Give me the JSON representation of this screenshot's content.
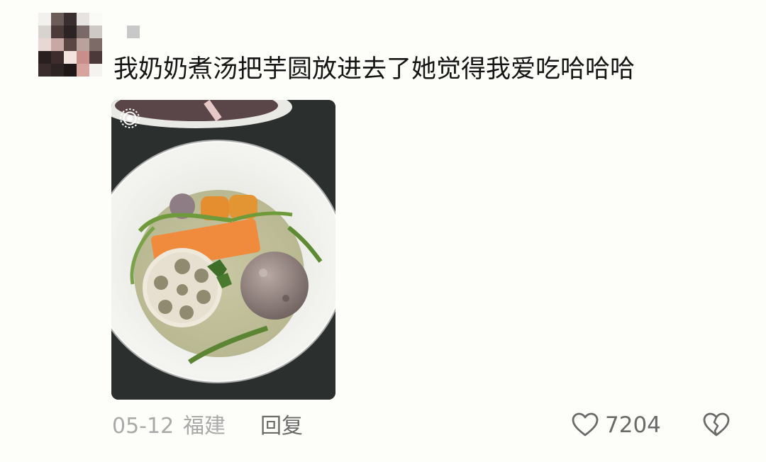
{
  "comment": {
    "text": "我奶奶煮汤把芋圆放进去了她觉得我爱吃哈哈哈",
    "author_avatar_icon": "pixelated-avatar",
    "author_name_icon": "pixelated-username",
    "photo_badge_icon": "live-photo-icon",
    "photo_icon": "food-photo-lotus-root-soup"
  },
  "meta": {
    "date": "05-12",
    "location": "福建",
    "reply_label": "回复"
  },
  "actions": {
    "like_icon": "heart-outline-icon",
    "like_count": "7204",
    "dislike_icon": "broken-heart-icon"
  },
  "colors": {
    "background": "#fdfdf9",
    "text": "#151515",
    "meta_text": "#a9a9a9",
    "action_text": "#6a6a6a"
  }
}
